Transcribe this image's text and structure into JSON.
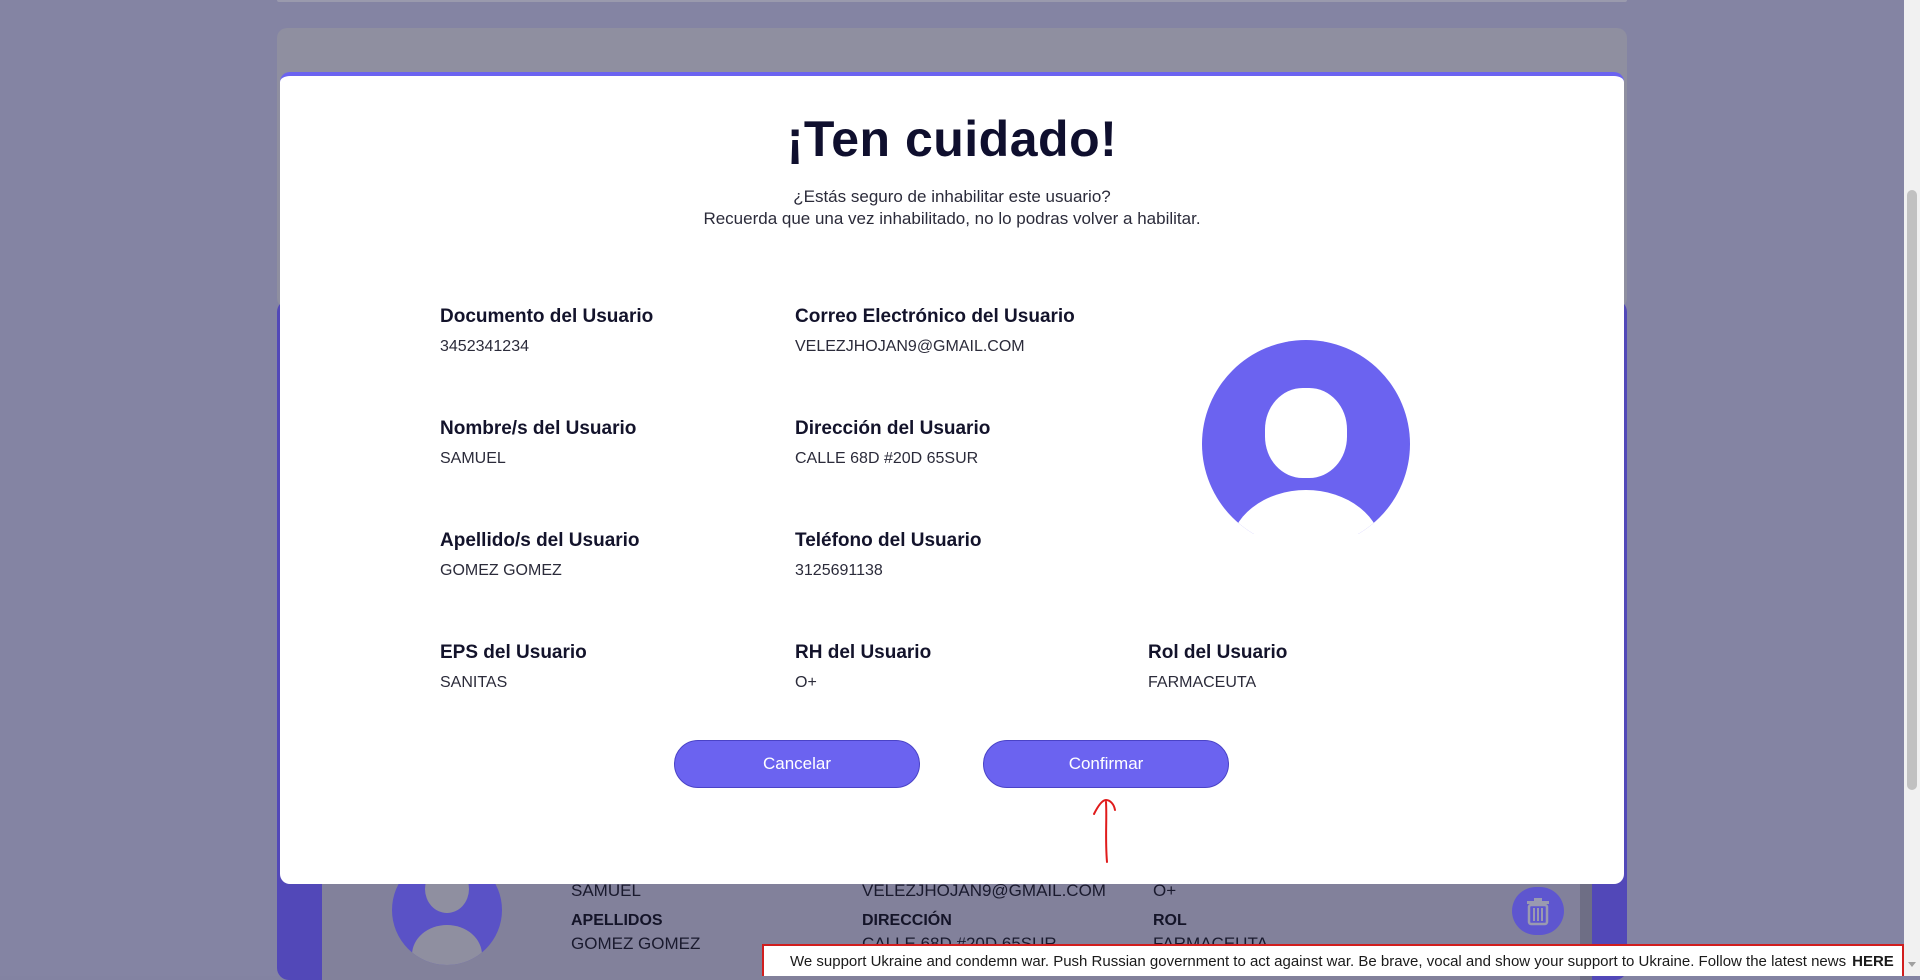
{
  "modal": {
    "title": "¡Ten cuidado!",
    "subtitle_line1": "¿Estás seguro de inhabilitar este usuario?",
    "subtitle_line2": "Recuerda que una vez inhabilitado, no lo podras volver a habilitar.",
    "fields": {
      "documento": {
        "label": "Documento del Usuario",
        "value": "3452341234"
      },
      "correo": {
        "label": "Correo Electrónico del Usuario",
        "value": "VELEZJHOJAN9@GMAIL.COM"
      },
      "nombre": {
        "label": "Nombre/s del Usuario",
        "value": "SAMUEL"
      },
      "direccion": {
        "label": "Dirección del Usuario",
        "value": "CALLE 68D #20D 65SUR"
      },
      "apellido": {
        "label": "Apellido/s del Usuario",
        "value": "GOMEZ GOMEZ"
      },
      "telefono": {
        "label": "Teléfono del Usuario",
        "value": "3125691138"
      },
      "eps": {
        "label": "EPS del Usuario",
        "value": "SANITAS"
      },
      "rh": {
        "label": "RH del Usuario",
        "value": "O+"
      },
      "rol": {
        "label": "Rol del Usuario",
        "value": "FARMACEUTA"
      }
    },
    "cancel_label": "Cancelar",
    "confirm_label": "Confirmar"
  },
  "background_card": {
    "nombre_value": "SAMUEL",
    "correo_value": "VELEZJHOJAN9@GMAIL.COM",
    "rh_value": "O+",
    "apellidos_label": "APELLIDOS",
    "apellidos_value": "GOMEZ GOMEZ",
    "direccion_label": "DIRECCIÓN",
    "direccion_value": "CALLE 68D #20D 65SUR",
    "rol_label": "ROL",
    "rol_value": "FARMACEUTA"
  },
  "banner": {
    "text": "We support Ukraine and condemn war. Push Russian government to act against war. Be brave, vocal and show your support to Ukraine. Follow the latest news",
    "link": "HERE"
  },
  "colors": {
    "accent": "#6b63f0",
    "overlay": "#8484a3",
    "banner_border": "#d11e1e"
  }
}
